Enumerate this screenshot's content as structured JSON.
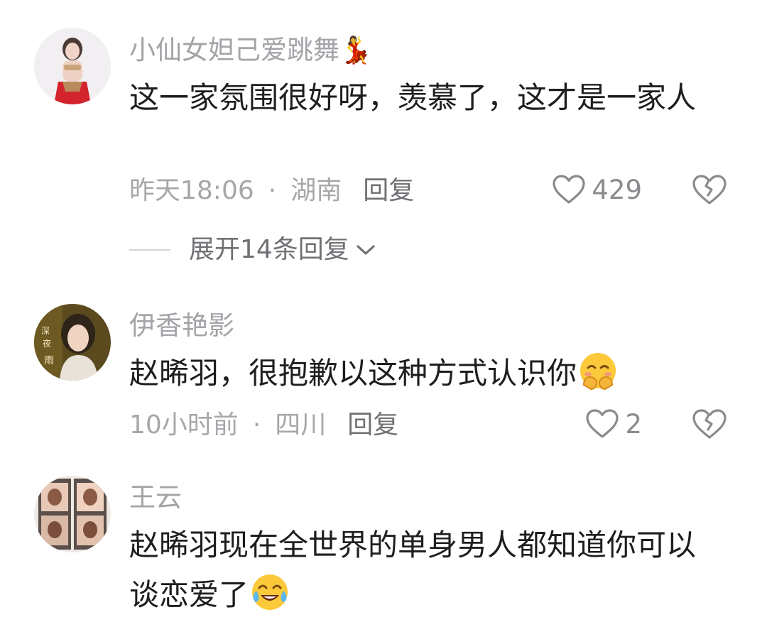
{
  "comments": [
    {
      "username": "小仙女妲己爱跳舞💃",
      "text": "这一家氛围很好呀，羡慕了，这才是一家人",
      "emoji": "",
      "time": "昨天18:06",
      "location": "湖南",
      "reply_label": "回复",
      "likes": "429",
      "avatar_icon": "dancer-avatar"
    },
    {
      "username": "伊香艳影",
      "text": "赵晞羽，很抱歉以这种方式认识你",
      "emoji": "shy-smile-emoji",
      "time": "10小时前",
      "location": "四川",
      "reply_label": "回复",
      "likes": "2",
      "avatar_icon": "woman-portrait-avatar"
    },
    {
      "username": "王云",
      "text": "赵晞羽现在全世界的单身男人都知道你可以谈恋爱了",
      "emoji": "tears-of-joy-emoji",
      "avatar_icon": "photo-collage-avatar"
    }
  ],
  "expand_replies": {
    "label": "展开14条回复"
  },
  "separator": "·",
  "colors": {
    "username": "#a3a3a8",
    "body_text": "#1e1e1e",
    "meta": "#a7a7ab",
    "reply": "#707075"
  }
}
